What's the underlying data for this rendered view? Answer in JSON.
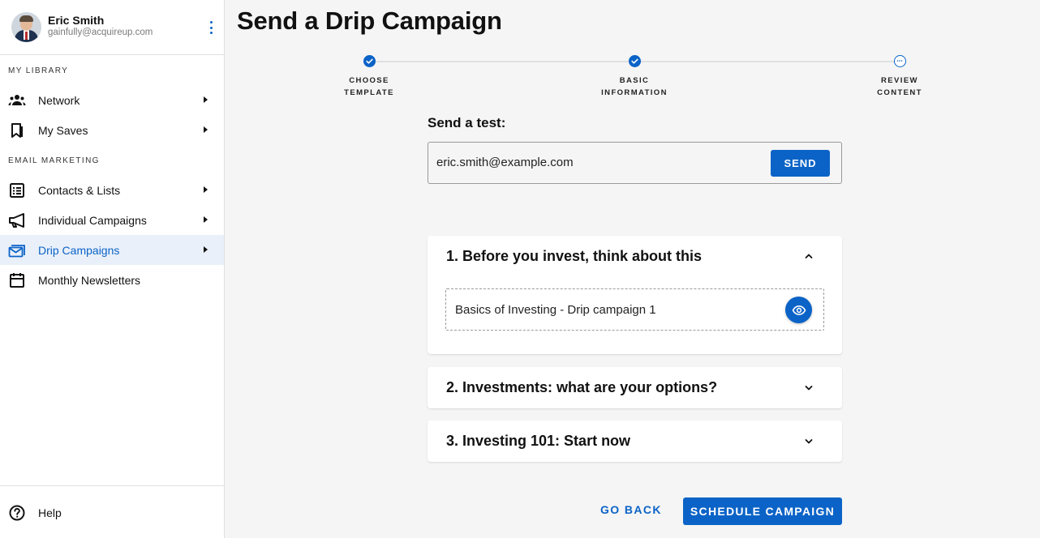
{
  "profile": {
    "name": "Eric Smith",
    "email": "gainfully@acquireup.com"
  },
  "sidebar": {
    "section_library": "MY LIBRARY",
    "section_email": "EMAIL MARKETING",
    "items": [
      {
        "label": "Network",
        "icon": "people-icon"
      },
      {
        "label": "My Saves",
        "icon": "bookmark-icon"
      },
      {
        "label": "Contacts & Lists",
        "icon": "list-icon"
      },
      {
        "label": "Individual Campaigns",
        "icon": "megaphone-icon"
      },
      {
        "label": "Drip Campaigns",
        "icon": "mail-icon",
        "active": true
      },
      {
        "label": "Monthly Newsletters",
        "icon": "calendar-icon"
      }
    ],
    "help_label": "Help"
  },
  "page": {
    "title": "Send a Drip Campaign"
  },
  "stepper": {
    "steps": [
      {
        "line1": "CHOOSE",
        "line2": "TEMPLATE",
        "status": "complete"
      },
      {
        "line1": "BASIC",
        "line2": "INFORMATION",
        "status": "complete"
      },
      {
        "line1": "REVIEW",
        "line2": "CONTENT",
        "status": "current"
      }
    ]
  },
  "test": {
    "heading": "Send a test:",
    "email_value": "eric.smith@example.com",
    "send_label": "SEND"
  },
  "campaigns": [
    {
      "title": "1. Before you invest, think about this",
      "expanded": true,
      "content": "Basics of Investing - Drip campaign 1"
    },
    {
      "title": "2. Investments: what are your options?",
      "expanded": false
    },
    {
      "title": "3. Investing 101: Start now",
      "expanded": false
    }
  ],
  "footer": {
    "back_label": "GO BACK",
    "schedule_label": "SCHEDULE CAMPAIGN"
  },
  "colors": {
    "accent": "#0b63c7",
    "active_bg": "#e9f0fa",
    "page_bg": "#f5f5f5"
  }
}
